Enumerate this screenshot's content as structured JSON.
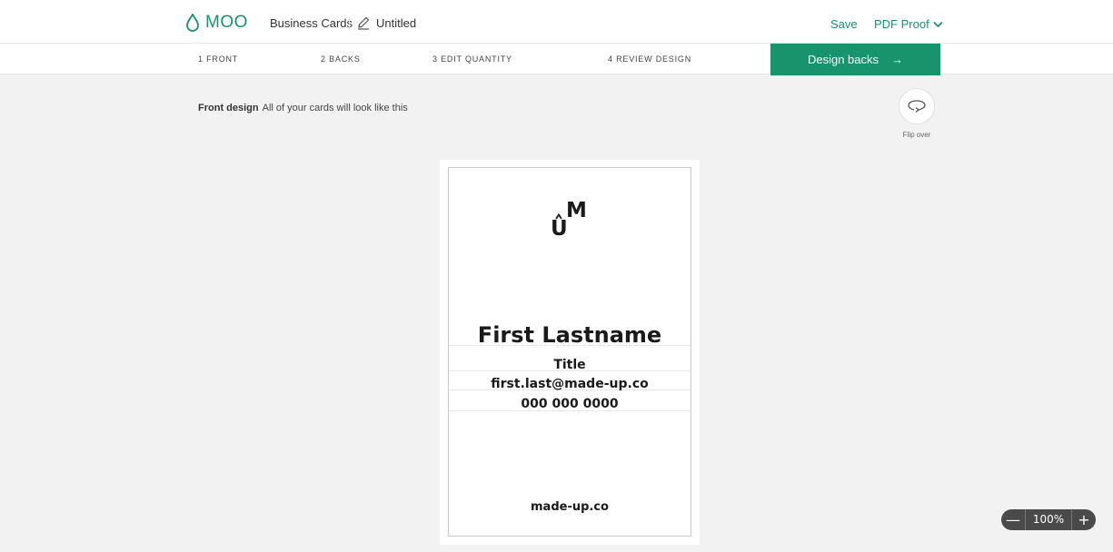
{
  "header": {
    "logo_text": "MOO",
    "product": "Business Cards",
    "document_name": "Untitled",
    "save_label": "Save",
    "pdf_proof_label": "PDF Proof"
  },
  "steps": [
    {
      "label": "1 FRONT"
    },
    {
      "label": "2 BACKS"
    },
    {
      "label": "3 EDIT QUANTITY"
    },
    {
      "label": "4 REVIEW DESIGN"
    }
  ],
  "cta": {
    "label": "Design backs",
    "arrow": "→"
  },
  "canvas": {
    "front_label_bold": "Front design",
    "front_label_text": "All of your cards will look like this",
    "flip_label": "Flip over"
  },
  "card": {
    "logo_m": "M",
    "logo_u": "U",
    "name": "First Lastname",
    "title": "Title",
    "email": "first.last@made-up.co",
    "phone": "000 000 0000",
    "website": "made-up.co"
  },
  "zoom": {
    "minus": "—",
    "value": "100%",
    "plus": "+"
  },
  "colors": {
    "brand_green": "#17946b",
    "background": "#f2f2f2",
    "zoom_bg": "#4a4a4a"
  },
  "icons": [
    "moo-drop-icon",
    "pencil-icon",
    "chevron-down-icon",
    "arrow-right-icon",
    "flip-icon"
  ]
}
